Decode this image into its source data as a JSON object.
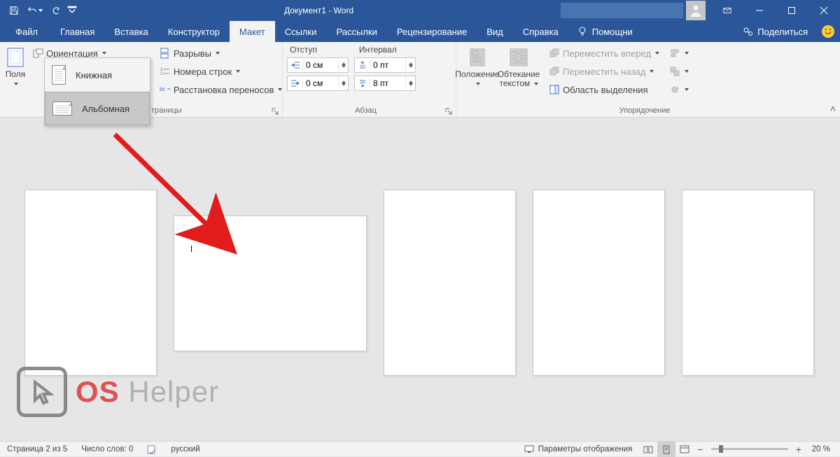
{
  "title": "Документ1  -  Word",
  "tabs": {
    "file": "Файл",
    "home": "Главная",
    "insert": "Вставка",
    "design": "Конструктор",
    "layout": "Макет",
    "refs": "Ссылки",
    "mailings": "Рассылки",
    "review": "Рецензирование",
    "view": "Вид",
    "help": "Справка",
    "tell": "Помощни",
    "share": "Поделиться"
  },
  "ribbon": {
    "margins": "Поля",
    "orientation": "Ориентация",
    "orientation_menu": {
      "portrait": "Книжная",
      "landscape": "Альбомная"
    },
    "breaks": "Разрывы",
    "line_numbers": "Номера строк",
    "hyphenation": "Расстановка переносов",
    "page_setup_group": "траницы",
    "indent_label": "Отступ",
    "spacing_label": "Интервал",
    "indent_left": "0 см",
    "indent_right": "0 см",
    "spacing_before": "0 пт",
    "spacing_after": "8 пт",
    "paragraph_group": "Абзац",
    "position": "Положение",
    "wrap_line1": "Обтекание",
    "wrap_line2": "текстом",
    "bring_forward": "Переместить вперед",
    "send_backward": "Переместить назад",
    "selection_pane": "Область выделения",
    "arrange_group": "Упорядочение"
  },
  "status": {
    "page": "Страница 2 из 5",
    "words": "Число слов: 0",
    "lang": "русский",
    "display_settings": "Параметры отображения",
    "zoom": "20 %"
  },
  "watermark": {
    "os": "OS",
    "helper": " Helper"
  }
}
